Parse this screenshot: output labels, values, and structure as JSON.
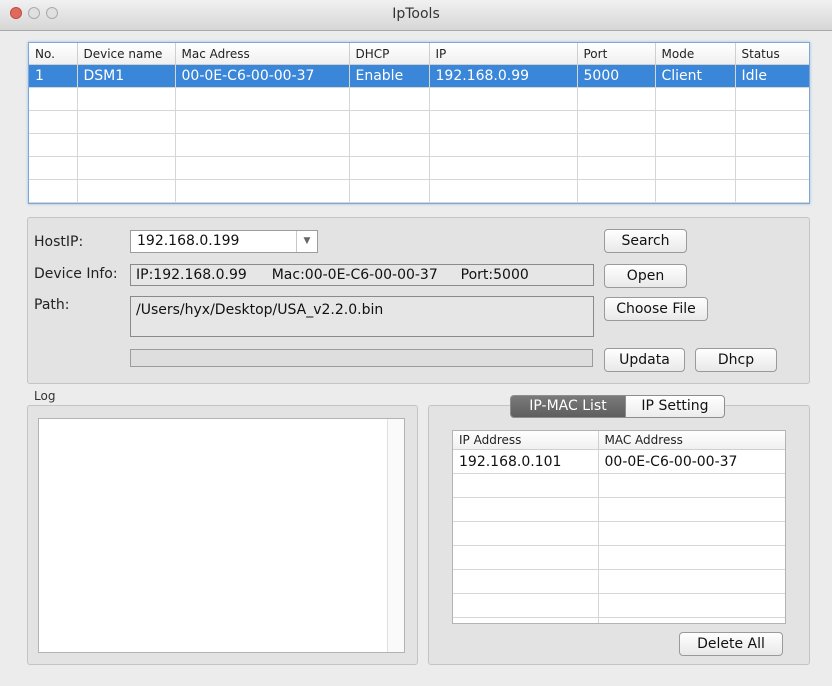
{
  "window": {
    "title": "IpTools"
  },
  "device_table": {
    "columns": [
      "No.",
      "Device name",
      "Mac Adress",
      "DHCP",
      "IP",
      "Port",
      "Mode",
      "Status"
    ],
    "rows": [
      [
        "1",
        "DSM1",
        "00-0E-C6-00-00-37",
        "Enable",
        "192.168.0.99",
        "5000",
        "Client",
        "Idle"
      ]
    ]
  },
  "settings": {
    "hostip_label": "HostIP:",
    "hostip_value": "192.168.0.199",
    "device_info_label": "Device Info:",
    "device_info_ip": "IP:192.168.0.99",
    "device_info_mac": "Mac:00-0E-C6-00-00-37",
    "device_info_port": "Port:5000",
    "path_label": "Path:",
    "path_value": "/Users/hyx/Desktop/USA_v2.2.0.bin",
    "search_label": "Search",
    "open_label": "Open",
    "choose_file_label": "Choose File",
    "updata_label": "Updata",
    "dhcp_label": "Dhcp"
  },
  "log": {
    "title": "Log"
  },
  "tabs": {
    "ip_mac_list": "IP-MAC List",
    "ip_setting": "IP Setting"
  },
  "mac_table": {
    "columns": [
      "IP Address",
      "MAC Address"
    ],
    "rows": [
      [
        "192.168.0.101",
        "00-0E-C6-00-00-37"
      ]
    ]
  },
  "delete_all_label": "Delete All"
}
